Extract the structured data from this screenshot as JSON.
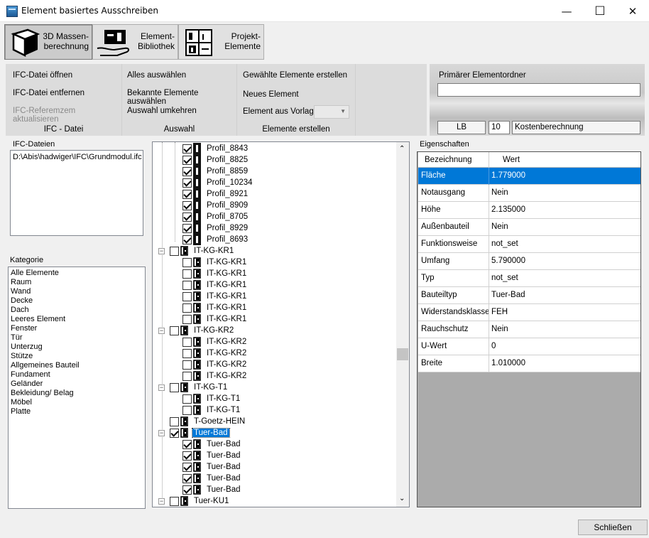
{
  "window": {
    "title": "Element basiertes Ausschreiben",
    "min": "—",
    "max": "☐",
    "close": "✕"
  },
  "toolbar": {
    "masse_line1": "3D Massen-",
    "masse_line2": "berechnung",
    "bib_line1": "Element-",
    "bib_line2": "Bibliothek",
    "proj_line1": "Projekt-",
    "proj_line2": "Elemente"
  },
  "ribbon": {
    "ifc": {
      "open": "IFC-Datei öffnen",
      "remove": "IFC-Datei entfernen",
      "refresh": "IFC-Referemzem aktualisieren",
      "caption": "IFC - Datei"
    },
    "auswahl": {
      "all": "Alles auswählen",
      "known": "Bekannte Elemente auswählen",
      "invert": "Auswahl umkehren",
      "caption": "Auswahl"
    },
    "elemente": {
      "create": "Gewählte Elemente erstellen",
      "new": "Neues Element",
      "from_template": "Element aus Vorlage",
      "caption": "Elemente erstellen"
    }
  },
  "primary": {
    "label": "Primärer Elementordner",
    "value": "",
    "lb": "LB",
    "num": "10",
    "cost": "Kostenberechnung"
  },
  "ifc_files": {
    "title": "IFC-Dateien",
    "items": [
      "D:\\Abis\\hadwiger\\IFC\\Grundmodul.ifc"
    ]
  },
  "kategorie": {
    "title": "Kategorie",
    "items": [
      "Alle Elemente",
      "Raum",
      "Wand",
      "Decke",
      "Dach",
      "Leeres Element",
      "Fenster",
      "Tür",
      "Unterzug",
      "Stütze",
      "Allgemeines Bauteil",
      "Fundament",
      "Geländer",
      "Bekleidung/ Belag",
      "Möbel",
      "Platte"
    ]
  },
  "tree": {
    "rows": [
      {
        "label": "Profil_8843",
        "level": 2,
        "checked": true,
        "icon": "profile"
      },
      {
        "label": "Profil_8825",
        "level": 2,
        "checked": true,
        "icon": "profile"
      },
      {
        "label": "Profil_8859",
        "level": 2,
        "checked": true,
        "icon": "profile"
      },
      {
        "label": "Profil_10234",
        "level": 2,
        "checked": true,
        "icon": "profile"
      },
      {
        "label": "Profil_8921",
        "level": 2,
        "checked": true,
        "icon": "profile"
      },
      {
        "label": "Profil_8909",
        "level": 2,
        "checked": true,
        "icon": "profile"
      },
      {
        "label": "Profil_8705",
        "level": 2,
        "checked": true,
        "icon": "profile"
      },
      {
        "label": "Profil_8929",
        "level": 2,
        "checked": true,
        "icon": "profile"
      },
      {
        "label": "Profil_8693",
        "level": 2,
        "checked": true,
        "icon": "profile"
      },
      {
        "label": "IT-KG-KR1",
        "level": 1,
        "checked": false,
        "icon": "door",
        "expander": "⊟"
      },
      {
        "label": "IT-KG-KR1",
        "level": 2,
        "checked": false,
        "icon": "door"
      },
      {
        "label": "IT-KG-KR1",
        "level": 2,
        "checked": false,
        "icon": "door"
      },
      {
        "label": "IT-KG-KR1",
        "level": 2,
        "checked": false,
        "icon": "door"
      },
      {
        "label": "IT-KG-KR1",
        "level": 2,
        "checked": false,
        "icon": "door"
      },
      {
        "label": "IT-KG-KR1",
        "level": 2,
        "checked": false,
        "icon": "door"
      },
      {
        "label": "IT-KG-KR1",
        "level": 2,
        "checked": false,
        "icon": "door"
      },
      {
        "label": "IT-KG-KR2",
        "level": 1,
        "checked": false,
        "icon": "door",
        "expander": "⊟"
      },
      {
        "label": "IT-KG-KR2",
        "level": 2,
        "checked": false,
        "icon": "door"
      },
      {
        "label": "IT-KG-KR2",
        "level": 2,
        "checked": false,
        "icon": "door"
      },
      {
        "label": "IT-KG-KR2",
        "level": 2,
        "checked": false,
        "icon": "door"
      },
      {
        "label": "IT-KG-KR2",
        "level": 2,
        "checked": false,
        "icon": "door"
      },
      {
        "label": "IT-KG-T1",
        "level": 1,
        "checked": false,
        "icon": "door",
        "expander": "⊟"
      },
      {
        "label": "IT-KG-T1",
        "level": 2,
        "checked": false,
        "icon": "door"
      },
      {
        "label": "IT-KG-T1",
        "level": 2,
        "checked": false,
        "icon": "door"
      },
      {
        "label": "T-Goetz-HEIN",
        "level": 1,
        "checked": false,
        "icon": "door"
      },
      {
        "label": "Tuer-Bad",
        "level": 1,
        "checked": true,
        "icon": "door",
        "expander": "⊟",
        "selected": true
      },
      {
        "label": "Tuer-Bad",
        "level": 2,
        "checked": true,
        "icon": "door"
      },
      {
        "label": "Tuer-Bad",
        "level": 2,
        "checked": true,
        "icon": "door"
      },
      {
        "label": "Tuer-Bad",
        "level": 2,
        "checked": true,
        "icon": "door"
      },
      {
        "label": "Tuer-Bad",
        "level": 2,
        "checked": true,
        "icon": "door"
      },
      {
        "label": "Tuer-Bad",
        "level": 2,
        "checked": true,
        "icon": "door"
      },
      {
        "label": "Tuer-KU1",
        "level": 1,
        "checked": false,
        "icon": "door",
        "expander": "⊟"
      }
    ]
  },
  "eigenschaften": {
    "title": "Eigenschaften",
    "col_name": "Bezeichnung",
    "col_value": "Wert",
    "rows": [
      {
        "name": "Fläche",
        "value": "1.779000",
        "selected": true
      },
      {
        "name": "Notausgang",
        "value": "Nein"
      },
      {
        "name": "Höhe",
        "value": "2.135000"
      },
      {
        "name": "Außenbauteil",
        "value": "Nein"
      },
      {
        "name": "Funktionsweise",
        "value": "not_set"
      },
      {
        "name": "Umfang",
        "value": "5.790000"
      },
      {
        "name": "Typ",
        "value": "not_set"
      },
      {
        "name": "Bauteiltyp",
        "value": "Tuer-Bad"
      },
      {
        "name": "Widerstandsklasse",
        "value": "FEH"
      },
      {
        "name": "Rauchschutz",
        "value": "Nein"
      },
      {
        "name": "U-Wert",
        "value": "0"
      },
      {
        "name": "Breite",
        "value": "1.010000"
      }
    ]
  },
  "footer": {
    "close": "Schließen"
  }
}
